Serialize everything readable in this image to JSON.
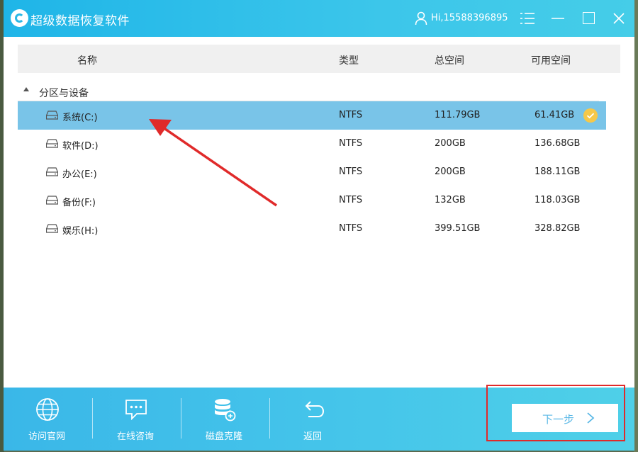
{
  "window": {
    "title": "超级数据恢复软件"
  },
  "titlebar": {
    "user": "Hi,15588396895"
  },
  "table": {
    "headers": {
      "name": "名称",
      "type": "类型",
      "total": "总空间",
      "free": "可用空间"
    },
    "group_label": "分区与设备",
    "rows": [
      {
        "name": "系统(C:)",
        "type": "NTFS",
        "total": "111.79GB",
        "free": "61.41GB",
        "selected": true
      },
      {
        "name": "软件(D:)",
        "type": "NTFS",
        "total": "200GB",
        "free": "136.68GB",
        "selected": false
      },
      {
        "name": "办公(E:)",
        "type": "NTFS",
        "total": "200GB",
        "free": "188.11GB",
        "selected": false
      },
      {
        "name": "备份(F:)",
        "type": "NTFS",
        "total": "132GB",
        "free": "118.03GB",
        "selected": false
      },
      {
        "name": "娱乐(H:)",
        "type": "NTFS",
        "total": "399.51GB",
        "free": "328.82GB",
        "selected": false
      }
    ]
  },
  "bottombar": {
    "buttons": [
      {
        "label": "访问官网",
        "icon": "globe-icon"
      },
      {
        "label": "在线咨询",
        "icon": "chat-icon"
      },
      {
        "label": "磁盘克隆",
        "icon": "database-icon"
      },
      {
        "label": "返回",
        "icon": "back-arrow-icon"
      }
    ],
    "next_label": "下一步"
  },
  "colors": {
    "accent": "#2ab8e6",
    "selected_row": "#79c4e8",
    "check_badge": "#f5c84a",
    "annotation_red": "#e02a2a"
  }
}
